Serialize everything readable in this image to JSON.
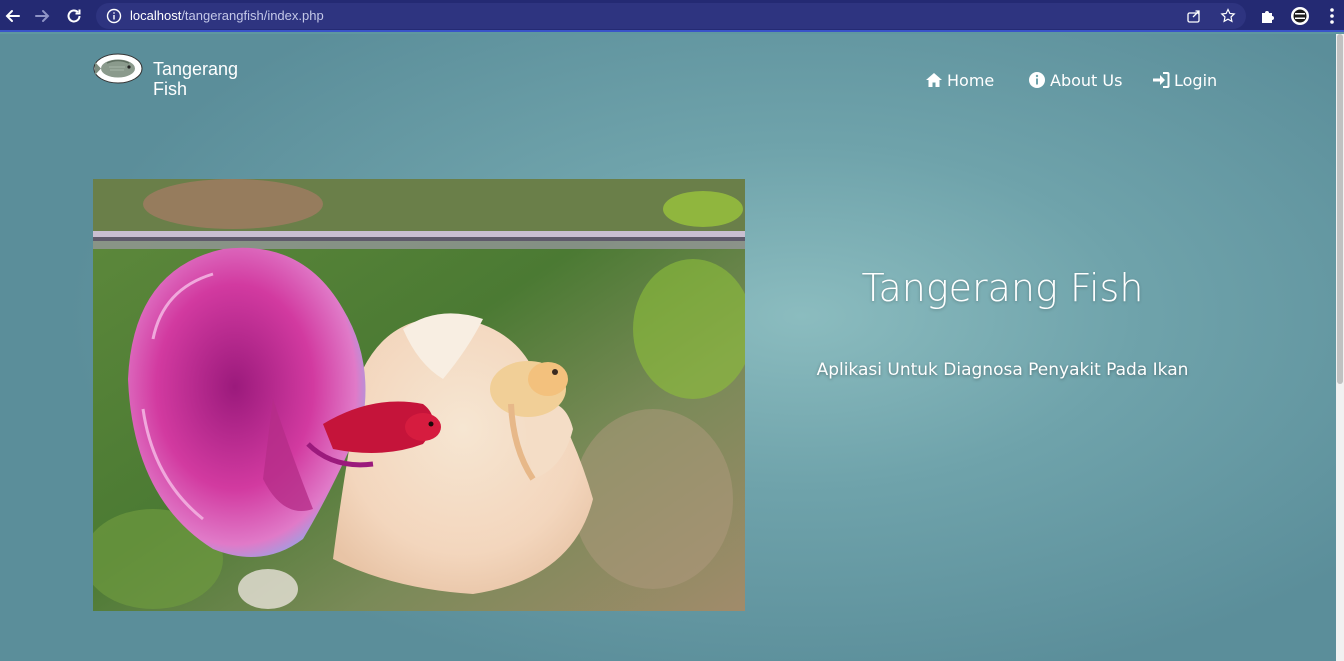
{
  "browser": {
    "url_host": "localhost",
    "url_path": "/tangerangfish/index.php"
  },
  "brand": {
    "name": "Tangerang Fish",
    "logo_icon": "fish-logo-icon"
  },
  "nav": {
    "items": [
      {
        "label": "Home",
        "icon": "home-icon"
      },
      {
        "label": "About Us",
        "icon": "info-circle-icon"
      },
      {
        "label": "Login",
        "icon": "sign-in-icon"
      }
    ]
  },
  "hero": {
    "title": "Tangerang Fish",
    "subtitle": "Aplikasi Untuk Diagnosa Penyakit Pada Ikan",
    "image_subject": "two betta fish in aquarium"
  },
  "colors": {
    "browser_bar": "#242a73",
    "page_background": "#6fa3ab",
    "text": "#ffffff"
  }
}
